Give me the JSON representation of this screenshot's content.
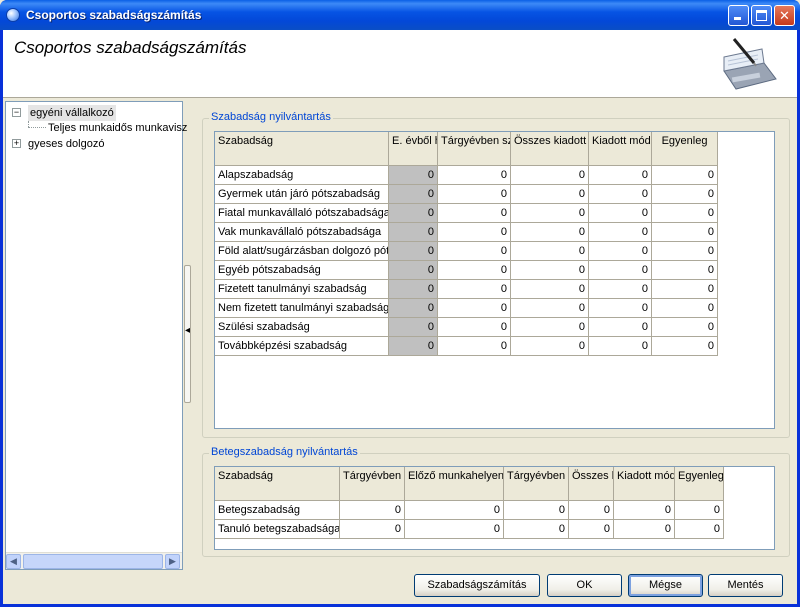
{
  "window": {
    "title": "Csoportos szabadságszámítás"
  },
  "header": {
    "title": "Csoportos szabadságszámítás"
  },
  "tree": {
    "nodes": [
      {
        "label": "egyéni vállalkozó",
        "expander": "−"
      },
      {
        "label": "Teljes munkaidős munkavisz"
      },
      {
        "label": "gyeses dolgozó",
        "expander": "+"
      }
    ]
  },
  "leave_section": {
    "label": "Szabadság nyilvántartás",
    "headers": [
      "Szabadság",
      "E. évből hozott",
      "Tárgyévben számított",
      "Összes kiadott",
      "Kiadott módosítása",
      "Egyenleg"
    ],
    "rows": [
      {
        "name": "Alapszabadság",
        "values": [
          "0",
          "0",
          "0",
          "0",
          "0"
        ]
      },
      {
        "name": "Gyermek után járó pótszabadság",
        "values": [
          "0",
          "0",
          "0",
          "0",
          "0"
        ]
      },
      {
        "name": "Fiatal munkavállaló pótszabadsága",
        "values": [
          "0",
          "0",
          "0",
          "0",
          "0"
        ]
      },
      {
        "name": "Vak munkavállaló pótszabadsága",
        "values": [
          "0",
          "0",
          "0",
          "0",
          "0"
        ]
      },
      {
        "name": "Föld alatt/sugárzásban dolgozó pót",
        "values": [
          "0",
          "0",
          "0",
          "0",
          "0"
        ]
      },
      {
        "name": "Egyéb pótszabadság",
        "values": [
          "0",
          "0",
          "0",
          "0",
          "0"
        ]
      },
      {
        "name": "Fizetett tanulmányi szabadság",
        "values": [
          "0",
          "0",
          "0",
          "0",
          "0"
        ]
      },
      {
        "name": "Nem fizetett tanulmányi szabadság",
        "values": [
          "0",
          "0",
          "0",
          "0",
          "0"
        ]
      },
      {
        "name": "Szülési szabadság",
        "values": [
          "0",
          "0",
          "0",
          "0",
          "0"
        ]
      },
      {
        "name": "Továbbképzési szabadság",
        "values": [
          "0",
          "0",
          "0",
          "0",
          "0"
        ]
      }
    ]
  },
  "sick_section": {
    "label": "Betegszabadság nyilvántartás",
    "headers": [
      "Szabadság",
      "Tárgyévben számított",
      "Előző munkahelyen felhasznált",
      "Tárgyévben adható",
      "Összes kiadott",
      "Kiadott módosítása",
      "Egyenleg"
    ],
    "rows": [
      {
        "name": "Betegszabadság",
        "values": [
          "0",
          "0",
          "0",
          "0",
          "0",
          "0"
        ]
      },
      {
        "name": "Tanuló betegszabadsága",
        "values": [
          "0",
          "0",
          "0",
          "0",
          "0",
          "0"
        ]
      }
    ]
  },
  "buttons": {
    "calculate": "Szabadságszámítás",
    "ok": "OK",
    "cancel": "Mégse",
    "save": "Mentés"
  }
}
